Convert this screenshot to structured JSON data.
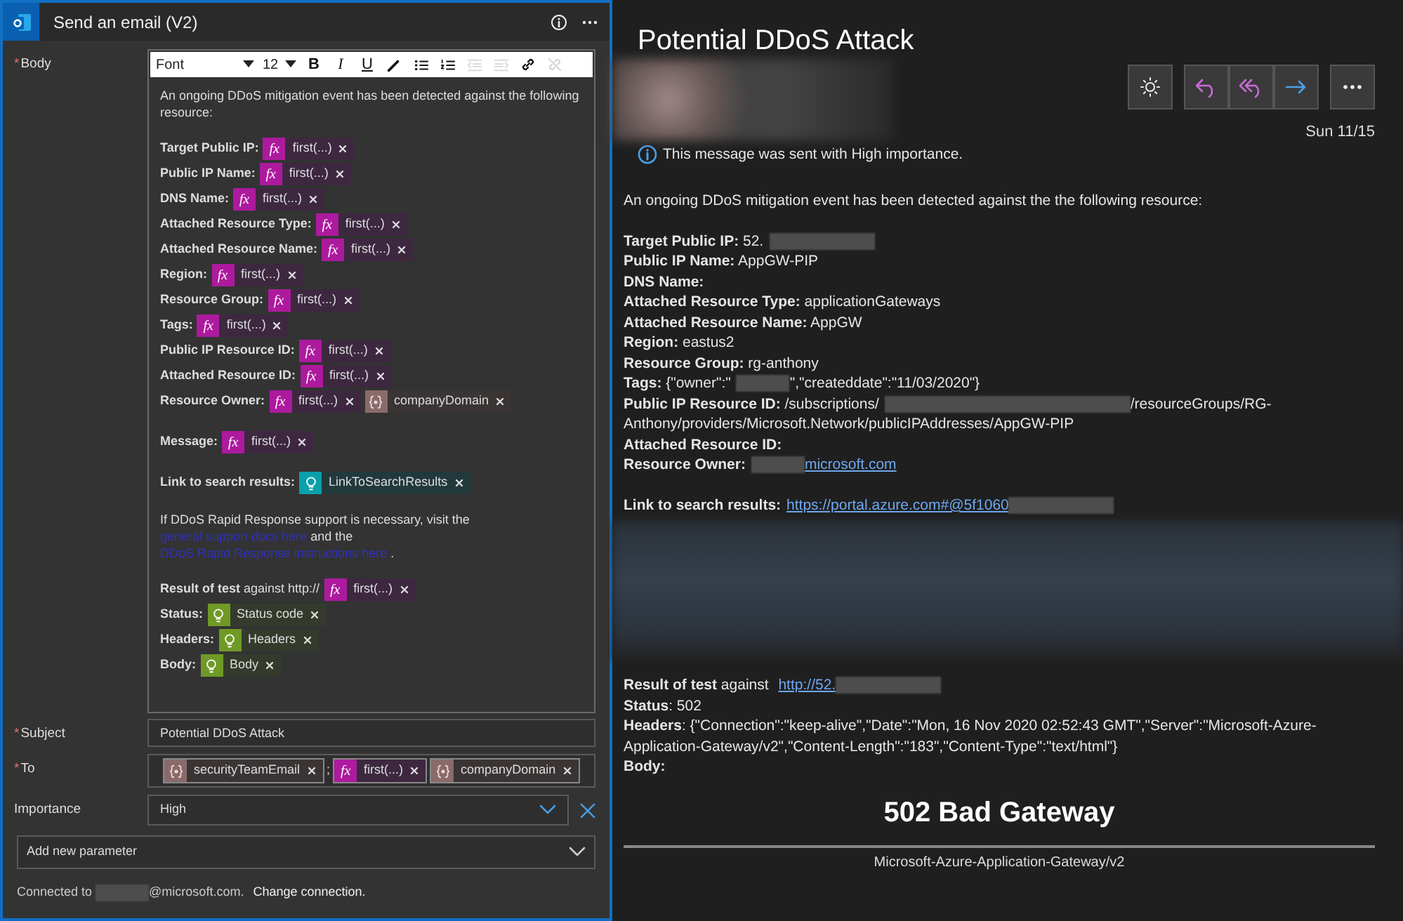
{
  "window": {
    "title": "Send an email (V2)"
  },
  "body_editor": {
    "label": "Body",
    "required_mark": "*",
    "toolbar": {
      "font": "Font",
      "size": "12",
      "buttons": [
        {
          "kind": "bold",
          "label": "B",
          "disabled": false
        },
        {
          "kind": "italic",
          "label": "I",
          "disabled": false
        },
        {
          "kind": "underline",
          "label": "U",
          "disabled": false
        },
        {
          "kind": "color",
          "disabled": false
        },
        {
          "kind": "bullets",
          "disabled": false
        },
        {
          "kind": "numbering",
          "disabled": false
        },
        {
          "kind": "outdent",
          "disabled": true
        },
        {
          "kind": "indent",
          "disabled": true
        },
        {
          "kind": "link",
          "disabled": false
        },
        {
          "kind": "unlink",
          "disabled": true
        }
      ]
    },
    "paragraphs": [
      {
        "lines": [
          {
            "parts": [
              {
                "kind": "text",
                "text": "An ongoing DDoS mitigation event has been detected against the following resource:"
              }
            ]
          }
        ]
      },
      {
        "lines": [
          {
            "parts": [
              {
                "kind": "bold",
                "text": "Target Public IP:"
              },
              {
                "kind": "expression",
                "icon": "fx",
                "label": "first(...)"
              }
            ]
          },
          {
            "parts": [
              {
                "kind": "bold",
                "text": "Public IP Name:"
              },
              {
                "kind": "expression",
                "icon": "fx",
                "label": "first(...)"
              }
            ]
          },
          {
            "parts": [
              {
                "kind": "bold",
                "text": "DNS Name:"
              },
              {
                "kind": "expression",
                "icon": "fx",
                "label": "first(...)"
              }
            ]
          },
          {
            "parts": [
              {
                "kind": "bold",
                "text": "Attached Resource Type:"
              },
              {
                "kind": "expression",
                "icon": "fx",
                "label": "first(...)"
              }
            ]
          },
          {
            "parts": [
              {
                "kind": "bold",
                "text": "Attached Resource Name:"
              },
              {
                "kind": "expression",
                "icon": "fx",
                "label": "first(...)"
              }
            ]
          },
          {
            "parts": [
              {
                "kind": "bold",
                "text": "Region:"
              },
              {
                "kind": "expression",
                "icon": "fx",
                "label": "first(...)"
              }
            ]
          },
          {
            "parts": [
              {
                "kind": "bold",
                "text": "Resource Group:"
              },
              {
                "kind": "expression",
                "icon": "fx",
                "label": "first(...)"
              }
            ]
          },
          {
            "parts": [
              {
                "kind": "bold",
                "text": "Tags:"
              },
              {
                "kind": "expression",
                "icon": "fx",
                "label": "first(...)"
              }
            ]
          },
          {
            "parts": [
              {
                "kind": "bold",
                "text": "Public IP Resource ID:"
              },
              {
                "kind": "expression",
                "icon": "fx",
                "label": "first(...)"
              }
            ]
          },
          {
            "parts": [
              {
                "kind": "bold",
                "text": "Attached Resource ID:"
              },
              {
                "kind": "expression",
                "icon": "fx",
                "label": "first(...)"
              }
            ]
          },
          {
            "parts": [
              {
                "kind": "bold",
                "text": "Resource Owner:"
              },
              {
                "kind": "expression",
                "icon": "fx",
                "label": "first(...)"
              },
              {
                "kind": "variable",
                "label": "companyDomain"
              }
            ]
          }
        ]
      },
      {
        "lines": [
          {
            "parts": [
              {
                "kind": "bold",
                "text": "Message:"
              },
              {
                "kind": "expression",
                "icon": "fx",
                "label": "first(...)"
              }
            ]
          }
        ]
      },
      {
        "lines": [
          {
            "parts": [
              {
                "kind": "bold",
                "text": "Link to search results:"
              },
              {
                "kind": "trigger",
                "label": "LinkToSearchResults"
              }
            ]
          }
        ]
      },
      {
        "lines": [
          {
            "parts": [
              {
                "kind": "text",
                "text": "If DDoS Rapid Response support is necessary, visit the "
              },
              {
                "kind": "link",
                "text": "general support docs here"
              },
              {
                "kind": "text",
                "text": " and the "
              },
              {
                "kind": "link",
                "text": "DDoS Rapid Response instructions here"
              },
              {
                "kind": "text",
                "text": " ."
              }
            ]
          }
        ]
      },
      {
        "lines": [
          {
            "parts": [
              {
                "kind": "bold",
                "text": "Result of test"
              },
              {
                "kind": "text",
                "text": " against http://"
              },
              {
                "kind": "expression",
                "icon": "fx",
                "label": "first(...)"
              }
            ]
          },
          {
            "parts": [
              {
                "kind": "bold",
                "text": "Status:"
              },
              {
                "kind": "http",
                "label": "Status code"
              }
            ]
          },
          {
            "parts": [
              {
                "kind": "bold",
                "text": "Headers:"
              },
              {
                "kind": "http",
                "label": "Headers"
              }
            ]
          },
          {
            "parts": [
              {
                "kind": "bold",
                "text": "Body:"
              },
              {
                "kind": "http",
                "label": "Body"
              }
            ]
          }
        ]
      }
    ]
  },
  "subject": {
    "label": "Subject",
    "required_mark": "*",
    "value": "Potential DDoS Attack"
  },
  "to": {
    "label": "To",
    "required_mark": "*",
    "parts": [
      {
        "kind": "variable",
        "label": "securityTeamEmail"
      },
      {
        "kind": "text",
        "text": ";"
      },
      {
        "kind": "expression",
        "icon": "fx",
        "label": "first(...)"
      },
      {
        "kind": "variable",
        "label": "companyDomain"
      }
    ]
  },
  "importance": {
    "label": "Importance",
    "value": "High"
  },
  "add_parameter": {
    "label": "Add new parameter"
  },
  "connection": {
    "parts": [
      {
        "kind": "text",
        "text": "Connected to "
      },
      {
        "kind": "redacted_short"
      },
      {
        "kind": "text",
        "text": "@microsoft.com. "
      },
      {
        "kind": "link",
        "text": "Change connection."
      }
    ]
  },
  "email": {
    "subject": "Potential DDoS Attack",
    "date": "Sun 11/15",
    "notice": "This message was sent with High importance.",
    "toolbar": [
      [
        {
          "kind": "brightness"
        }
      ],
      [
        {
          "kind": "reply"
        },
        {
          "kind": "reply_all"
        },
        {
          "kind": "forward"
        }
      ],
      [
        {
          "kind": "more"
        }
      ]
    ],
    "paragraphs": [
      {
        "kind": "text",
        "lines": [
          [
            {
              "kind": "text",
              "text": "An ongoing DDoS mitigation event has been detected against the the following resource:"
            }
          ]
        ]
      },
      {
        "kind": "text",
        "lines": [
          [
            {
              "kind": "bold",
              "text": "Target Public IP:"
            },
            {
              "kind": "text",
              "text": " 52."
            },
            {
              "kind": "redacted_medium"
            }
          ],
          [
            {
              "kind": "bold",
              "text": "Public IP Name:"
            },
            {
              "kind": "text",
              "text": " AppGW-PIP"
            }
          ],
          [
            {
              "kind": "bold",
              "text": "DNS Name:"
            }
          ],
          [
            {
              "kind": "bold",
              "text": "Attached Resource Type:"
            },
            {
              "kind": "text",
              "text": " applicationGateways"
            }
          ],
          [
            {
              "kind": "bold",
              "text": "Attached Resource Name:"
            },
            {
              "kind": "text",
              "text": " AppGW"
            }
          ],
          [
            {
              "kind": "bold",
              "text": "Region:"
            },
            {
              "kind": "text",
              "text": " eastus2"
            }
          ],
          [
            {
              "kind": "bold",
              "text": "Resource Group:"
            },
            {
              "kind": "text",
              "text": " rg-anthony"
            }
          ],
          [
            {
              "kind": "bold",
              "text": "Tags:"
            },
            {
              "kind": "text",
              "text": " {\"owner\":\""
            },
            {
              "kind": "redacted_short"
            },
            {
              "kind": "text",
              "text": "\",\"createddate\":\"11/03/2020\"}"
            }
          ],
          [
            {
              "kind": "bold",
              "text": "Public IP Resource ID:"
            },
            {
              "kind": "text",
              "text": " /subscriptions/"
            },
            {
              "kind": "redacted_long"
            },
            {
              "kind": "text",
              "text": "/resourceGroups/RG-Anthony/providers/Microsoft.Network/publicIPAddresses/AppGW-PIP"
            }
          ],
          [
            {
              "kind": "bold",
              "text": "Attached Resource ID:"
            }
          ],
          [
            {
              "kind": "bold",
              "text": "Resource Owner:"
            },
            {
              "kind": "redacted_short"
            },
            {
              "kind": "link",
              "text": "microsoft.com"
            }
          ]
        ]
      },
      {
        "kind": "text",
        "lines": [
          [
            {
              "kind": "bold",
              "text": "Link to search results:"
            },
            {
              "kind": "link",
              "text": "https://portal.azure.com#@5f1060"
            },
            {
              "kind": "redacted_medium"
            }
          ]
        ]
      },
      {
        "kind": "blur"
      },
      {
        "kind": "text",
        "lines": [
          [
            {
              "kind": "bold",
              "text": "Result of test"
            },
            {
              "kind": "text",
              "text": " against "
            },
            {
              "kind": "link",
              "text": "http://52."
            },
            {
              "kind": "redacted_medium"
            }
          ],
          [
            {
              "kind": "bold",
              "text": "Status"
            },
            {
              "kind": "text",
              "text": ": 502"
            }
          ],
          [
            {
              "kind": "bold",
              "text": "Headers"
            },
            {
              "kind": "text",
              "text": ": {\"Connection\":\"keep-alive\",\"Date\":\"Mon, 16 Nov 2020 02:52:43 GMT\",\"Server\":\"Microsoft-Azure-Application-Gateway/v2\",\"Content-Length\":\"183\",\"Content-Type\":\"text/html\"}"
            }
          ],
          [
            {
              "kind": "bold",
              "text": "Body:"
            }
          ]
        ]
      }
    ],
    "error_page": {
      "heading": "502 Bad Gateway",
      "server": "Microsoft-Azure-Application-Gateway/v2"
    }
  }
}
